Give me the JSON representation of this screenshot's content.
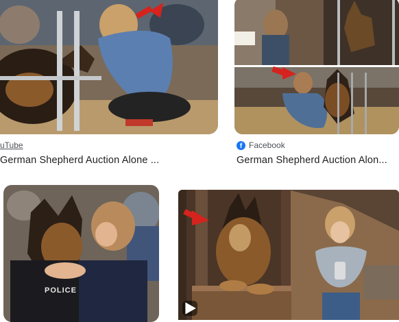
{
  "results": [
    {
      "source": "uTube",
      "source_icon": "none",
      "title": "German Shepherd Auction Alone ..."
    },
    {
      "source": "Facebook",
      "source_icon": "facebook-icon",
      "title": "German Shepherd Auction Alon..."
    },
    {
      "source": "",
      "source_icon": "none",
      "title": "",
      "lettering": "POLICE"
    },
    {
      "source": "",
      "source_icon": "none",
      "title": "",
      "has_video_badge": true
    }
  ],
  "colors": {
    "facebook": "#1877f2",
    "source_text": "#4d5156",
    "title_text": "#202124",
    "arrow": "#d6231d"
  }
}
